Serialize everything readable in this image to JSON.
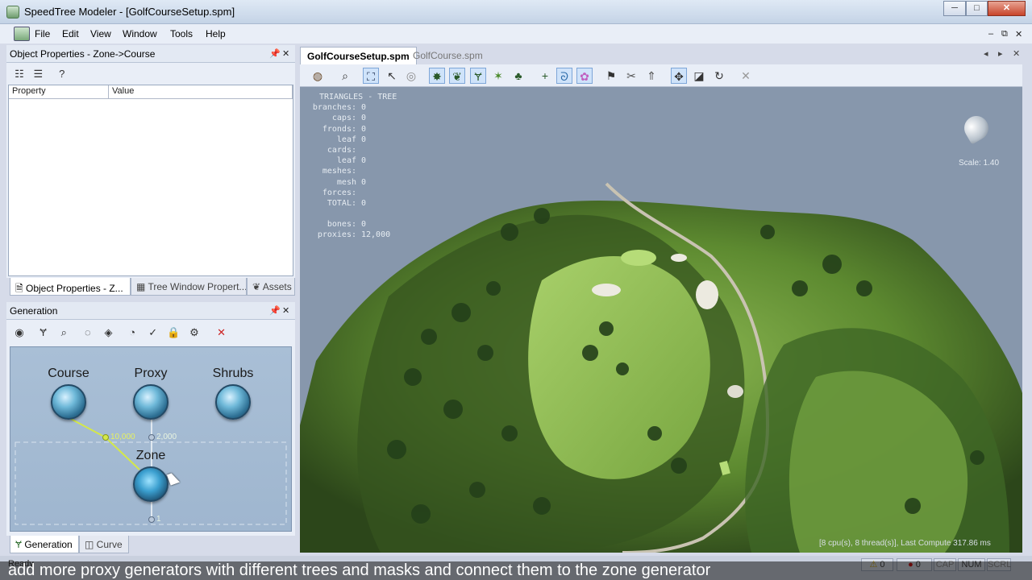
{
  "window": {
    "title": "SpeedTree Modeler - [GolfCourseSetup.spm]",
    "minimize": "─",
    "maximize": "□",
    "close": "✕"
  },
  "menu": {
    "items": [
      "File",
      "Edit",
      "View",
      "Window",
      "Tools",
      "Help"
    ],
    "mdi_min": "–",
    "mdi_restore": "⧉",
    "mdi_close": "✕"
  },
  "object_properties": {
    "title": "Object Properties - Zone->Course",
    "pin": "📌",
    "close": "✕",
    "columns": [
      "Property",
      "Value"
    ],
    "tabs": [
      "Object Properties - Z...",
      "Tree Window Propert...",
      "Assets"
    ]
  },
  "generation": {
    "title": "Generation",
    "pin": "📌",
    "close": "✕",
    "nodes": {
      "course": "Course",
      "proxy": "Proxy",
      "shrubs": "Shrubs",
      "zone": "Zone"
    },
    "ports": {
      "course_link": "10,000",
      "proxy_link": "2,000",
      "zone_out": "1"
    },
    "tabs": [
      "Generation",
      "Curve"
    ]
  },
  "viewport": {
    "tabs": [
      "GolfCourseSetup.spm",
      "GolfCourse.spm"
    ],
    "stats_title": "TRIANGLES - TREE",
    "stats": [
      {
        "k": "branches:",
        "v": "0"
      },
      {
        "k": "caps:",
        "v": "0"
      },
      {
        "k": "fronds:",
        "v": "0"
      },
      {
        "k": "leaf cards:",
        "v": "0"
      },
      {
        "k": "leaf meshes:",
        "v": "0"
      },
      {
        "k": "mesh forces:",
        "v": "0"
      },
      {
        "k": "TOTAL:",
        "v": "0"
      }
    ],
    "stats2": [
      {
        "k": "bones:",
        "v": "0"
      },
      {
        "k": "proxies:",
        "v": "12,000"
      }
    ],
    "scale": "Scale: 1.40",
    "compute": "[8 cpu(s), 8 thread(s)], Last Compute 317.86 ms"
  },
  "status": {
    "ready": "Ready",
    "warnings": "0",
    "errors": "0",
    "cap": "CAP",
    "num": "NUM",
    "scrl": "SCRL"
  },
  "caption": "add more proxy generators with different trees and masks and connect them to the zone generator",
  "colors": {
    "grass": "#6e9a3a",
    "forest": "#2d4a1c",
    "path": "#c9c3b2",
    "sky": "#8797ac"
  }
}
